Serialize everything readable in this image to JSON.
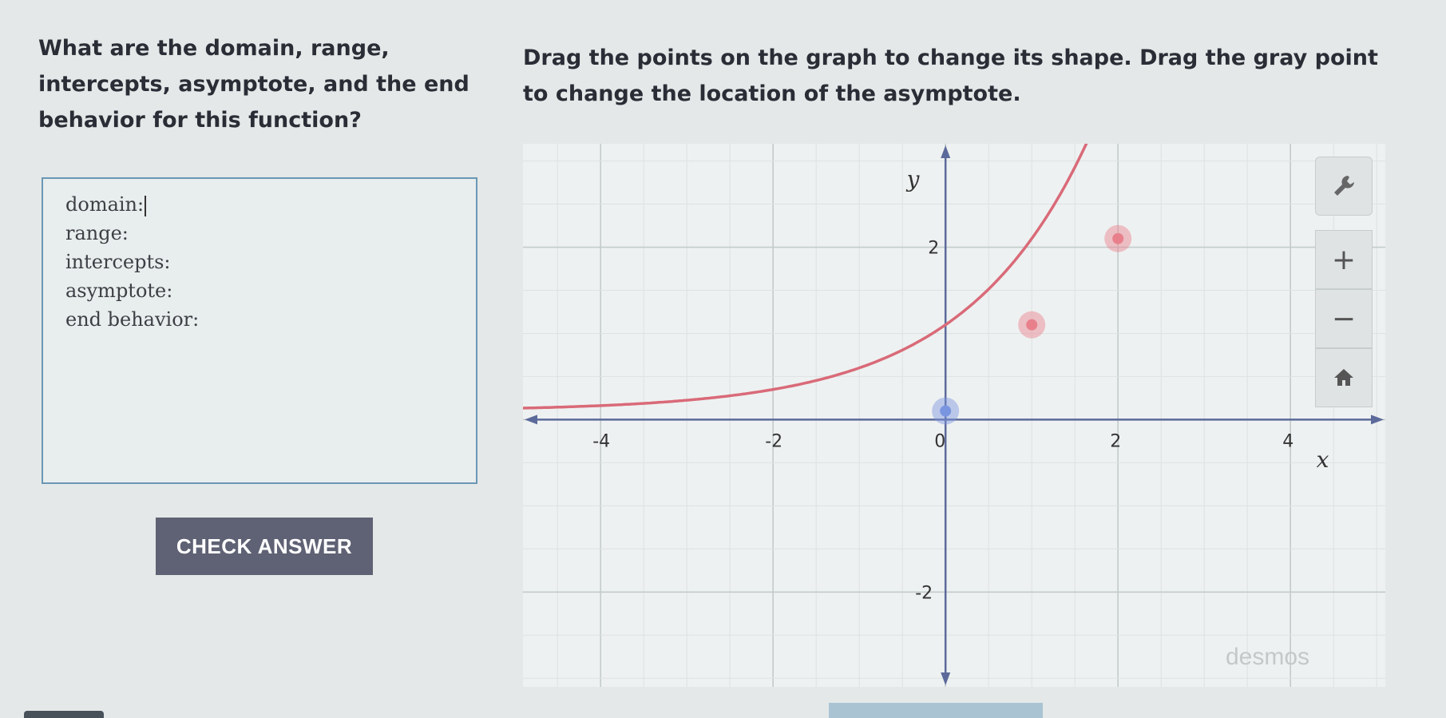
{
  "question": {
    "prompt": "What are the domain, range, intercepts, asymptote, and the end behavior for this function?",
    "instructions": "Drag the points on the graph to change its shape. Drag the gray point to change the location of the asymptote."
  },
  "answer_box": {
    "lines": [
      "domain:",
      "range:",
      "intercepts:",
      "asymptote:",
      "end behavior:"
    ]
  },
  "check_button": {
    "label": "CHECK ANSWER"
  },
  "graph": {
    "x_label": "x",
    "y_label": "y",
    "x_ticks": [
      {
        "value": -4,
        "label": "-4"
      },
      {
        "value": -2,
        "label": "-2"
      },
      {
        "value": 0,
        "label": "0"
      },
      {
        "value": 2,
        "label": "2"
      },
      {
        "value": 4,
        "label": "4"
      }
    ],
    "y_ticks": [
      {
        "value": 2,
        "label": "2"
      },
      {
        "value": -2,
        "label": "-2"
      }
    ],
    "x_range": [
      -4.9,
      5.1
    ],
    "y_range": [
      3.2,
      -3.1
    ],
    "asymptote_y": 0.1,
    "curve": {
      "type": "exponential",
      "asymptote": 0.1,
      "coefficient": 1,
      "base": 2,
      "color": "#d96a78"
    },
    "draggable_points": [
      {
        "x": 1,
        "y": 1.1,
        "color": "#e8808c"
      },
      {
        "x": 2,
        "y": 2.1,
        "color": "#e8808c"
      }
    ],
    "asymptote_point": {
      "x": 0,
      "y": 0.1,
      "color": "#7a95e0"
    },
    "axis_color": "#5b6a9a",
    "grid_color": "#cfd6d6"
  },
  "tools": {
    "wrench_icon": "wrench-icon",
    "zoom_in_symbol": "+",
    "zoom_out_symbol": "−",
    "home_icon": "home-icon"
  },
  "branding": {
    "name": "desmos"
  }
}
